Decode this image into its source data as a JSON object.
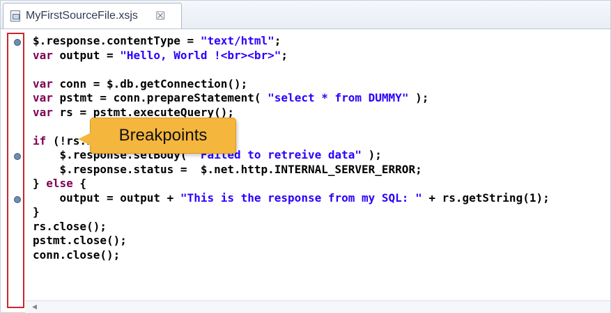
{
  "tab": {
    "title": "MyFirstSourceFile.xsjs",
    "close_glyph": "☒"
  },
  "code": {
    "lines": [
      [
        {
          "t": "$.response.contentType = "
        },
        {
          "t": "\"text/html\"",
          "c": "str"
        },
        {
          "t": ";"
        }
      ],
      [
        {
          "t": "var",
          "c": "kw"
        },
        {
          "t": " output = "
        },
        {
          "t": "\"Hello, World !<br><br>\"",
          "c": "str"
        },
        {
          "t": ";"
        }
      ],
      [
        {
          "t": ""
        }
      ],
      [
        {
          "t": "var",
          "c": "kw"
        },
        {
          "t": " conn = $.db.getConnection();"
        }
      ],
      [
        {
          "t": "var",
          "c": "kw"
        },
        {
          "t": " pstmt = conn.prepareStatement( "
        },
        {
          "t": "\"select * from DUMMY\"",
          "c": "str"
        },
        {
          "t": " );"
        }
      ],
      [
        {
          "t": "var",
          "c": "kw"
        },
        {
          "t": " rs = pstmt.executeQuery();"
        }
      ],
      [
        {
          "t": ""
        }
      ],
      [
        {
          "t": "if",
          "c": "kw"
        },
        {
          "t": " (!rs.next()) {"
        }
      ],
      [
        {
          "t": "    $.response.setBody( "
        },
        {
          "t": "\"Failed to retreive data\"",
          "c": "str"
        },
        {
          "t": " );"
        }
      ],
      [
        {
          "t": "    $.response.status =  $.net.http.INTERNAL_SERVER_ERROR;"
        }
      ],
      [
        {
          "t": "} "
        },
        {
          "t": "else",
          "c": "kw"
        },
        {
          "t": " {"
        }
      ],
      [
        {
          "t": "    output = output + "
        },
        {
          "t": "\"This is the response from my SQL: \"",
          "c": "str"
        },
        {
          "t": " + rs.getString(1);"
        }
      ],
      [
        {
          "t": "}"
        }
      ],
      [
        {
          "t": "rs.close();"
        }
      ],
      [
        {
          "t": "pstmt.close();"
        }
      ],
      [
        {
          "t": "conn.close();"
        }
      ]
    ],
    "breakpoint_lines": [
      1,
      9,
      12
    ]
  },
  "callout": {
    "label": "Breakpoints",
    "color": "#f4b63d"
  },
  "scrollbar": {
    "left_arrow": "◂"
  },
  "colors": {
    "keyword": "#7f0055",
    "string": "#2a00ff",
    "gutter_highlight": "#c9262c",
    "breakpoint": "#6f8db1"
  }
}
